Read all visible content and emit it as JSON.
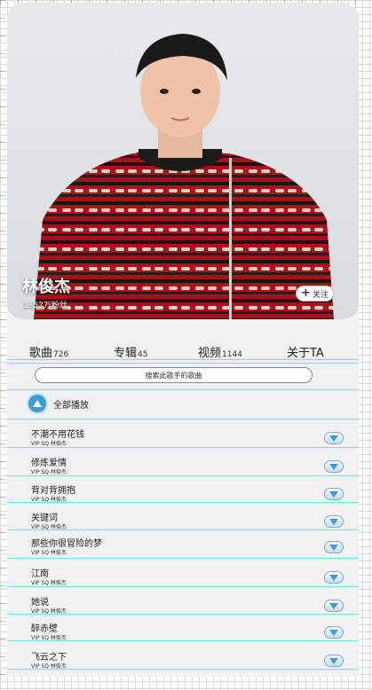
{
  "artist": {
    "name": "林俊杰",
    "fans": "1357万粉丝",
    "follow_label": "关注"
  },
  "tabs": [
    {
      "label": "歌曲",
      "count": "726"
    },
    {
      "label": "专辑",
      "count": "45"
    },
    {
      "label": "视频",
      "count": "1144"
    },
    {
      "label": "关于TA",
      "count": ""
    }
  ],
  "search": {
    "placeholder": "搜索此歌手的歌曲"
  },
  "play_all": {
    "label": "全部播放"
  },
  "songs": [
    {
      "title": "不潮不用花钱",
      "meta": "VIP SQ 林俊杰"
    },
    {
      "title": "修炼爱情",
      "meta": "VIP SQ 林俊杰"
    },
    {
      "title": "背对背拥抱",
      "meta": "VIP SQ 林俊杰"
    },
    {
      "title": "关键词",
      "meta": "VIP SQ 林俊杰"
    },
    {
      "title": "那些你很冒险的梦",
      "meta": "VIP SQ 林俊杰"
    },
    {
      "title": "江南",
      "meta": "VIP SQ 林俊杰"
    },
    {
      "title": "她说",
      "meta": "VIP SQ 林俊杰"
    },
    {
      "title": "醉赤壁",
      "meta": "VIP SQ 林俊杰"
    },
    {
      "title": "飞云之下",
      "meta": "VIP SQ 林俊杰"
    }
  ],
  "colors": {
    "accent": "#3d9bd8",
    "divider": "#6fe3ee",
    "sweater_red": "#b0141c"
  }
}
